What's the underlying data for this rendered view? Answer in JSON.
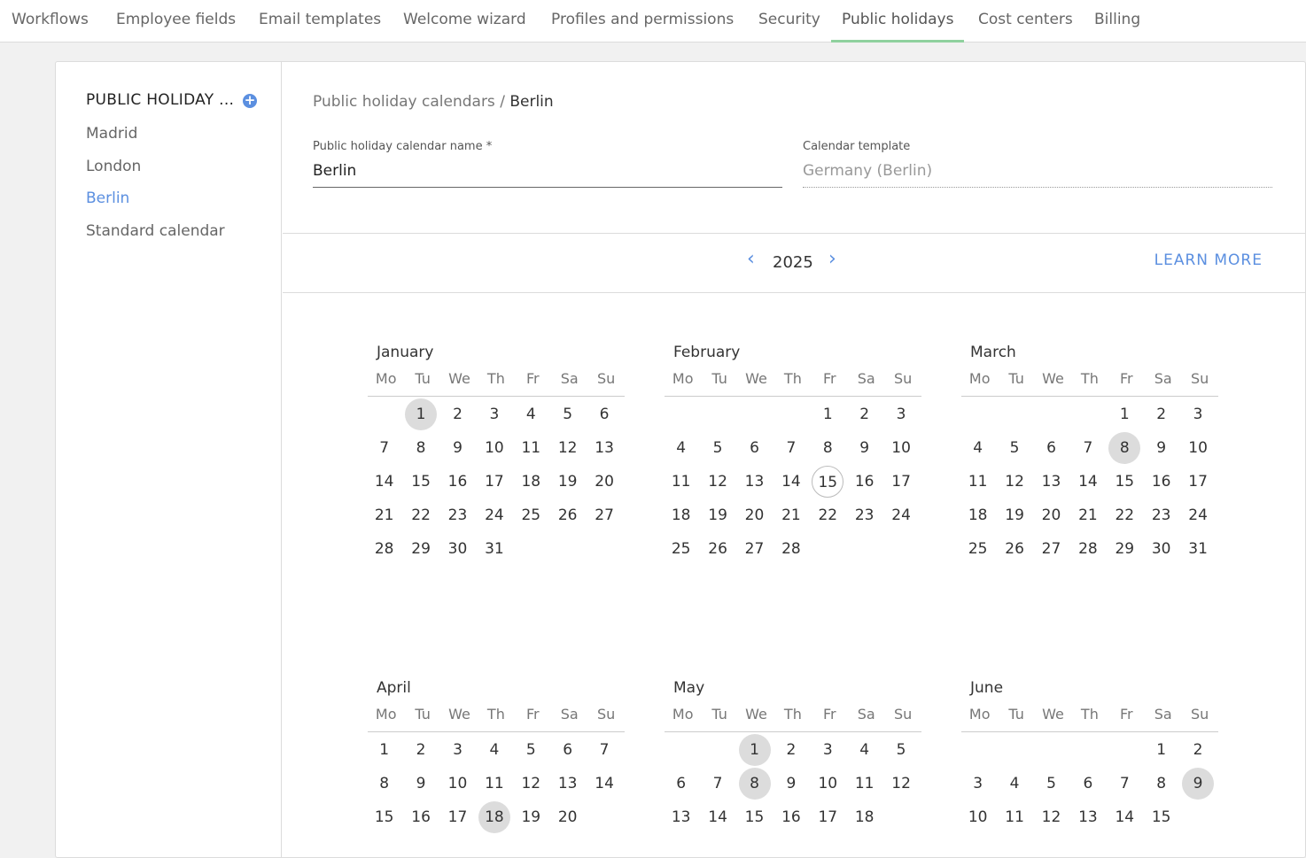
{
  "nav": {
    "tabs": [
      {
        "label": "Workflows"
      },
      {
        "label": "Employee fields"
      },
      {
        "label": "Email templates"
      },
      {
        "label": "Welcome wizard"
      },
      {
        "label": "Profiles and permissions"
      },
      {
        "label": "Security"
      },
      {
        "label": "Public holidays"
      },
      {
        "label": "Cost centers"
      },
      {
        "label": "Billing"
      }
    ],
    "active": "Public holidays"
  },
  "sidebar": {
    "heading": "PUBLIC HOLIDAY ...",
    "add_icon": "plus-circle-icon",
    "items": [
      {
        "label": "Madrid"
      },
      {
        "label": "London"
      },
      {
        "label": "Berlin"
      },
      {
        "label": "Standard calendar"
      }
    ],
    "active": "Berlin"
  },
  "breadcrumb": {
    "parent": "Public holiday calendars",
    "separator": "/",
    "current": "Berlin"
  },
  "form": {
    "name_label": "Public holiday calendar name *",
    "name_value": "Berlin",
    "template_label": "Calendar template",
    "template_value": "Germany (Berlin)"
  },
  "year_nav": {
    "prev_icon": "chevron-left-icon",
    "year": "2025",
    "next_icon": "chevron-right-icon",
    "learn_more": "LEARN MORE"
  },
  "weekdays": [
    "Mo",
    "Tu",
    "We",
    "Th",
    "Fr",
    "Sa",
    "Su"
  ],
  "months": [
    {
      "name": "January",
      "start": 2,
      "days": 31,
      "holidays": [
        1
      ],
      "today": []
    },
    {
      "name": "February",
      "start": 5,
      "days": 28,
      "holidays": [],
      "today": [
        15
      ]
    },
    {
      "name": "March",
      "start": 5,
      "days": 31,
      "holidays": [
        8
      ],
      "today": []
    },
    {
      "name": "April",
      "start": 1,
      "days": 20,
      "holidays": [
        18
      ],
      "today": []
    },
    {
      "name": "May",
      "start": 3,
      "days": 18,
      "holidays": [
        1,
        8
      ],
      "today": []
    },
    {
      "name": "June",
      "start": 6,
      "days": 15,
      "holidays": [
        9
      ],
      "today": []
    }
  ],
  "colors": {
    "accent": "#5b8fe0",
    "active_tab_underline": "#8fd19e",
    "holiday": "#dcdcdc"
  }
}
